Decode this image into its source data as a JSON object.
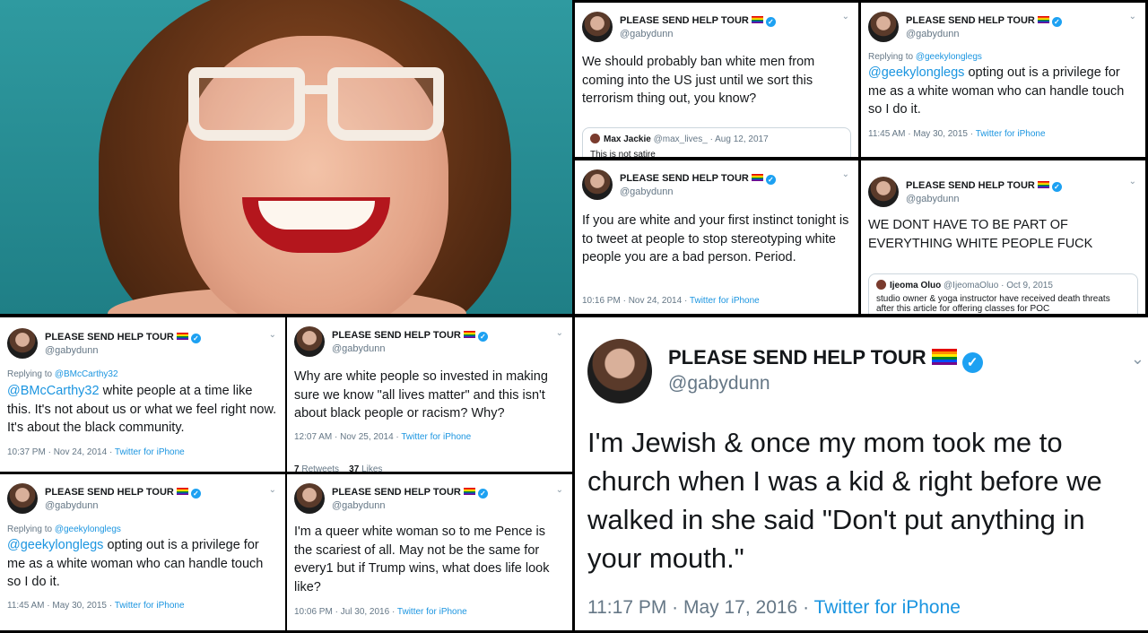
{
  "account": {
    "name": "PLEASE SEND HELP TOUR",
    "handle": "@gabydunn",
    "flag_icon": "rainbow-flag-icon",
    "verified_icon": "verified-badge-icon"
  },
  "colors": {
    "link": "#1b95e0",
    "muted": "#657786",
    "verified": "#1da1f2",
    "photo_bg": "#2f9aa0"
  },
  "tweets": [
    {
      "id": "t1",
      "text": "We should probably ban white men from coming into the US just until we sort this terrorism thing out, you know?",
      "quote": {
        "name": "Max Jackie",
        "handle": "@max_lives_",
        "date": "Aug 12, 2017",
        "text": "This is not satire"
      }
    },
    {
      "id": "t2",
      "replying_label": "Replying to",
      "replying_to": "@geekylonglegs",
      "mention": "@geekylonglegs",
      "text": " opting out is a privilege for me as a white woman who can handle touch so I do it.",
      "time": "11:45 AM · May 30, 2015",
      "sep": "·",
      "source": "Twitter for iPhone"
    },
    {
      "id": "t3",
      "text": "If you are white and your first instinct tonight is to tweet at people to stop stereotyping white people you are a bad person. Period.",
      "time": "10:16 PM · Nov 24, 2014",
      "sep": "·",
      "source": "Twitter for iPhone"
    },
    {
      "id": "t4",
      "text": "WE DONT HAVE TO BE PART OF EVERYTHING WHITE PEOPLE FUCK",
      "quote": {
        "name": "Ijeoma Oluo",
        "handle": "@IjeomaOluo",
        "date": "Oct 9, 2015",
        "text": "studio owner & yoga instructor have received death threats after this article for offering classes for POC"
      }
    },
    {
      "id": "t5",
      "replying_label": "Replying to",
      "replying_to": "@BMcCarthy32",
      "mention": "@BMcCarthy32",
      "text": " white people at a time like this. It's not about us or what we feel right now. It's about the black community.",
      "time": "10:37 PM · Nov 24, 2014",
      "sep": "·",
      "source": "Twitter for iPhone"
    },
    {
      "id": "t6",
      "text": "Why are white people so invested in making sure we know \"all lives matter\" and this isn't about black people or racism? Why?",
      "time": "12:07 AM · Nov 25, 2014",
      "sep": "·",
      "source": "Twitter for iPhone",
      "retweets": "7",
      "retweets_label": "Retweets",
      "likes": "37",
      "likes_label": "Likes"
    },
    {
      "id": "t7",
      "replying_label": "Replying to",
      "replying_to": "@geekylonglegs",
      "mention": "@geekylonglegs",
      "text": " opting out is a privilege for me as a white woman who can handle touch so I do it.",
      "time": "11:45 AM · May 30, 2015",
      "sep": "·",
      "source": "Twitter for iPhone"
    },
    {
      "id": "t8",
      "text": "I'm a queer white woman so to me Pence is the scariest of all. May not be the same for every1 but if Trump wins, what does life look like?",
      "time": "10:06 PM · Jul 30, 2016",
      "sep": "·",
      "source": "Twitter for iPhone"
    },
    {
      "id": "t9",
      "text": "I'm Jewish & once my mom took me to church when I was a kid & right before we walked in she said \"Don't put anything in your mouth.\"",
      "time": "11:17 PM · May 17, 2016",
      "sep": "·",
      "source": "Twitter for iPhone"
    }
  ]
}
